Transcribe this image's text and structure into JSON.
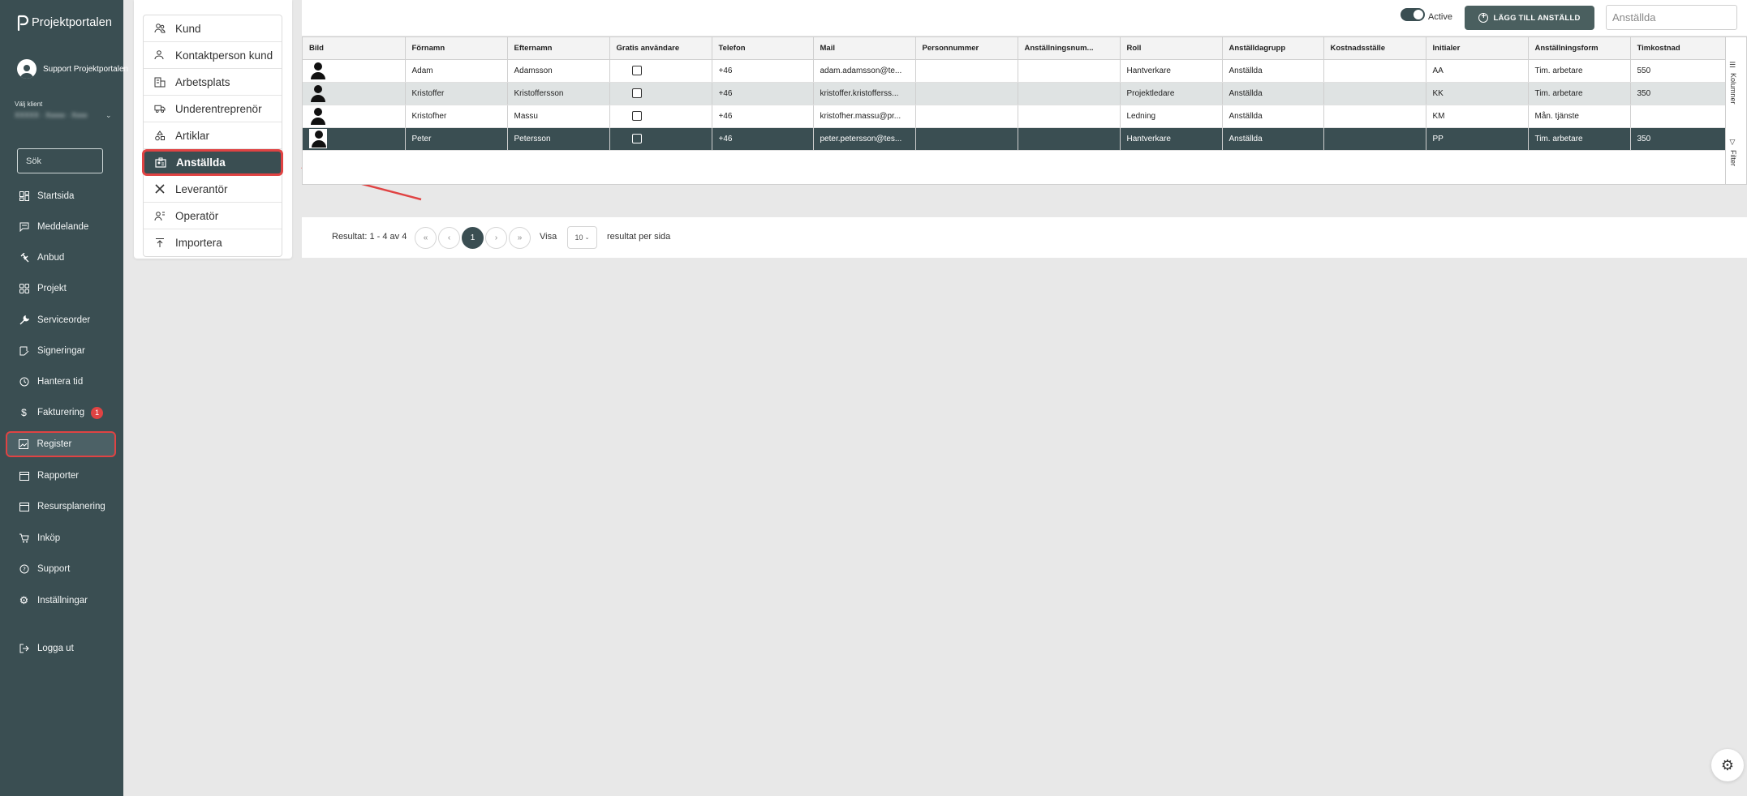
{
  "app": {
    "name": "Projektportalen"
  },
  "user": {
    "name": "Support Projektportalen"
  },
  "client": {
    "label": "Välj klient",
    "value": "XXXXX · Xxxxx · Xxxx"
  },
  "sidebar": {
    "search_placeholder": "Sök",
    "items": [
      {
        "label": "Startsida",
        "icon": "dashboard-icon"
      },
      {
        "label": "Meddelande",
        "icon": "message-icon"
      },
      {
        "label": "Anbud",
        "icon": "gavel-icon"
      },
      {
        "label": "Projekt",
        "icon": "grid-icon"
      },
      {
        "label": "Serviceorder",
        "icon": "wrench-icon"
      },
      {
        "label": "Signeringar",
        "icon": "sign-icon"
      },
      {
        "label": "Hantera tid",
        "icon": "clock-icon"
      },
      {
        "label": "Fakturering",
        "icon": "dollar-icon",
        "badge": "1"
      },
      {
        "label": "Register",
        "icon": "register-icon",
        "active": true
      },
      {
        "label": "Rapporter",
        "icon": "calendar-icon"
      },
      {
        "label": "Resursplanering",
        "icon": "calendar-icon"
      },
      {
        "label": "Inköp",
        "icon": "cart-icon"
      },
      {
        "label": "Support",
        "icon": "help-icon"
      },
      {
        "label": "Inställningar",
        "icon": "gear-icon"
      },
      {
        "label": "Logga ut",
        "icon": "logout-icon"
      }
    ]
  },
  "register_menu": {
    "items": [
      {
        "label": "Kund"
      },
      {
        "label": "Kontaktperson kund"
      },
      {
        "label": "Arbetsplats"
      },
      {
        "label": "Underentreprenör"
      },
      {
        "label": "Artiklar"
      },
      {
        "label": "Anställda",
        "active": true
      },
      {
        "label": "Leverantör"
      },
      {
        "label": "Operatör"
      },
      {
        "label": "Importera"
      }
    ]
  },
  "toolbar": {
    "active_label": "Active",
    "active_on": true,
    "add_button": "LÄGG TILL ANSTÄLLD",
    "search_placeholder": "Anställda"
  },
  "table": {
    "columns": [
      "Bild",
      "Förnamn",
      "Efternamn",
      "Gratis användare",
      "Telefon",
      "Mail",
      "Personnummer",
      "Anställningsnum...",
      "Roll",
      "Anställdagrupp",
      "Kostnadsställe",
      "Initialer",
      "Anställningsform",
      "Timkostnad"
    ],
    "rows": [
      [
        "",
        "Adam",
        "Adamsson",
        "",
        "+46",
        "adam.adamsson@te...",
        "",
        "",
        "Hantverkare",
        "Anställda",
        "",
        "AA",
        "Tim. arbetare",
        "550"
      ],
      [
        "",
        "Kristoffer",
        "Kristoffersson",
        "",
        "+46",
        "kristoffer.kristofferss...",
        "",
        "",
        "Projektledare",
        "Anställda",
        "",
        "KK",
        "Tim. arbetare",
        "350"
      ],
      [
        "",
        "Kristofher",
        "Massu",
        "",
        "+46",
        "kristofher.massu@pr...",
        "",
        "",
        "Ledning",
        "Anställda",
        "",
        "KM",
        "Mån. tjänste",
        ""
      ],
      [
        "",
        "Peter",
        "Petersson",
        "",
        "+46",
        "peter.petersson@tes...",
        "",
        "",
        "Hantverkare",
        "Anställda",
        "",
        "PP",
        "Tim. arbetare",
        "350"
      ]
    ],
    "side_tabs": {
      "columns": "Kolumner",
      "filter": "Filter"
    }
  },
  "pagination": {
    "result_text": "Resultat: 1 - 4 av 4",
    "first": "«",
    "prev": "‹",
    "current": "1",
    "next": "›",
    "last": "»",
    "show_label": "Visa",
    "per_page": "10",
    "per_page_label": "resultat per sida"
  },
  "colors": {
    "sidebar": "#3a4e52",
    "highlight": "#e04343",
    "selected_row": "#3a4e52",
    "alt_row": "#dfe3e3"
  }
}
